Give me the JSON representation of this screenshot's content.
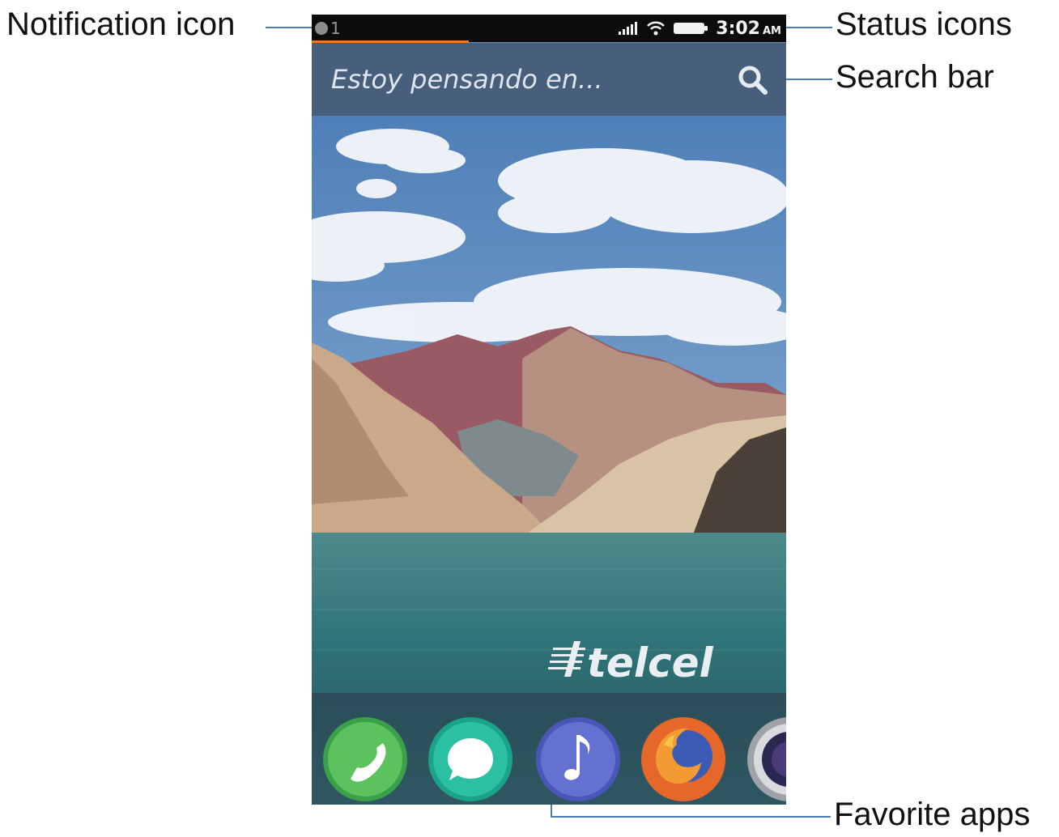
{
  "annotations": {
    "notification_icon": "Notification icon",
    "status_icons": "Status icons",
    "search_bar": "Search bar",
    "favorite_apps": "Favorite apps"
  },
  "status_bar": {
    "notification_count": "1",
    "time": "3:02",
    "ampm": "AM",
    "signal_icon": "signal-bars-icon",
    "wifi_icon": "wifi-icon",
    "battery_icon": "battery-icon"
  },
  "search": {
    "placeholder": "Estoy pensando en...",
    "icon": "magnifier-icon"
  },
  "wallpaper": {
    "watermark": "telcel"
  },
  "dock": {
    "apps": [
      "phone-icon",
      "messages-icon",
      "music-icon",
      "firefox-icon",
      "camera-icon"
    ]
  },
  "colors": {
    "status_progress": "#e77a2f",
    "leader_line": "#4b7fb3",
    "phone_green": "#3aa14a",
    "messages_teal": "#1aa38a",
    "music_blue": "#4a56b8",
    "firefox_orange": "#e5682a"
  }
}
